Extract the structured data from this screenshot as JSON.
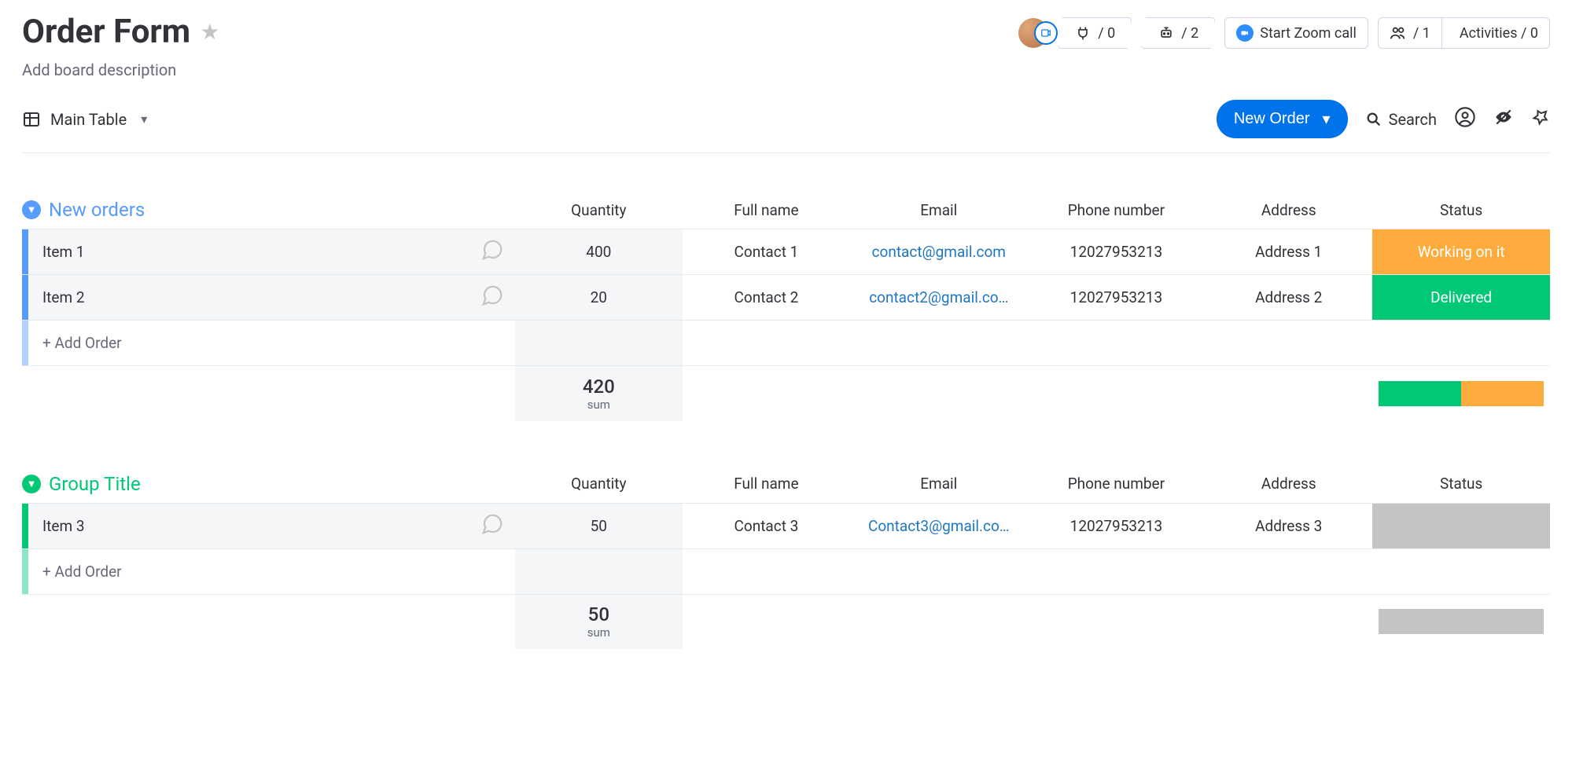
{
  "header": {
    "title": "Order Form",
    "description": "Add board description",
    "integrations_count": "/ 0",
    "automations_count": "/ 2",
    "zoom_label": "Start Zoom call",
    "members_count": "/ 1",
    "activities_label": "Activities / 0"
  },
  "toolbar": {
    "view_name": "Main Table",
    "new_order_label": "New Order",
    "search_label": "Search"
  },
  "columns": {
    "quantity": "Quantity",
    "full_name": "Full name",
    "email": "Email",
    "phone": "Phone number",
    "address": "Address",
    "status": "Status"
  },
  "status_colors": {
    "working": "#fdab3d",
    "delivered": "#00c875",
    "none": "#c4c4c4"
  },
  "groups": [
    {
      "title": "New orders",
      "color": "#579bfc",
      "add_label": "+ Add Order",
      "sum": "420",
      "sum_label": "sum",
      "summary_colors": [
        "#00c875",
        "#fdab3d"
      ],
      "items": [
        {
          "name": "Item 1",
          "quantity": "400",
          "full_name": "Contact 1",
          "email": "contact@gmail.com",
          "phone": "12027953213",
          "address": "Address 1",
          "status": "Working on it",
          "status_color": "#fdab3d"
        },
        {
          "name": "Item 2",
          "quantity": "20",
          "full_name": "Contact 2",
          "email": "contact2@gmail.co…",
          "phone": "12027953213",
          "address": "Address 2",
          "status": "Delivered",
          "status_color": "#00c875"
        }
      ]
    },
    {
      "title": "Group Title",
      "color": "#00c875",
      "add_label": "+ Add Order",
      "sum": "50",
      "sum_label": "sum",
      "summary_colors": [
        "#c4c4c4"
      ],
      "items": [
        {
          "name": "Item 3",
          "quantity": "50",
          "full_name": "Contact 3",
          "email": "Contact3@gmail.co…",
          "phone": "12027953213",
          "address": "Address 3",
          "status": "",
          "status_color": "#c4c4c4"
        }
      ]
    }
  ]
}
